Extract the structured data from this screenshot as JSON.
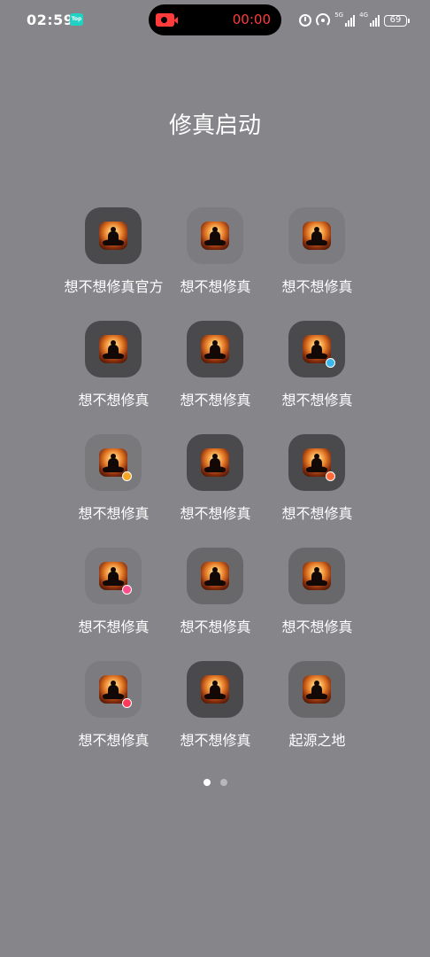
{
  "status_bar": {
    "time": "02:59",
    "top_badge": "Top",
    "recording_time": "00:00",
    "network_1": "5G",
    "network_2": "4G",
    "battery": "69"
  },
  "folder": {
    "title": "修真启动"
  },
  "apps": [
    {
      "label": "想不想修真官方",
      "tile": "dark",
      "badge": ""
    },
    {
      "label": "想不想修真",
      "tile": "faint",
      "badge": ""
    },
    {
      "label": "想不想修真",
      "tile": "faint",
      "badge": ""
    },
    {
      "label": "想不想修真",
      "tile": "dark",
      "badge": ""
    },
    {
      "label": "想不想修真",
      "tile": "dark",
      "badge": ""
    },
    {
      "label": "想不想修真",
      "tile": "dark",
      "badge": "#3bb6e8"
    },
    {
      "label": "想不想修真",
      "tile": "light",
      "badge": "#f5a623"
    },
    {
      "label": "想不想修真",
      "tile": "dark",
      "badge": ""
    },
    {
      "label": "想不想修真",
      "tile": "dark",
      "badge": "#ff6b3b"
    },
    {
      "label": "想不想修真",
      "tile": "faint",
      "badge": "#ff4d8a"
    },
    {
      "label": "想不想修真",
      "tile": "mid",
      "badge": ""
    },
    {
      "label": "想不想修真",
      "tile": "mid",
      "badge": ""
    },
    {
      "label": "想不想修真",
      "tile": "faint",
      "badge": "#ff3b5c"
    },
    {
      "label": "想不想修真",
      "tile": "dark",
      "badge": ""
    },
    {
      "label": "起源之地",
      "tile": "mid",
      "badge": ""
    }
  ],
  "pager": {
    "total": 2,
    "current": 1
  }
}
